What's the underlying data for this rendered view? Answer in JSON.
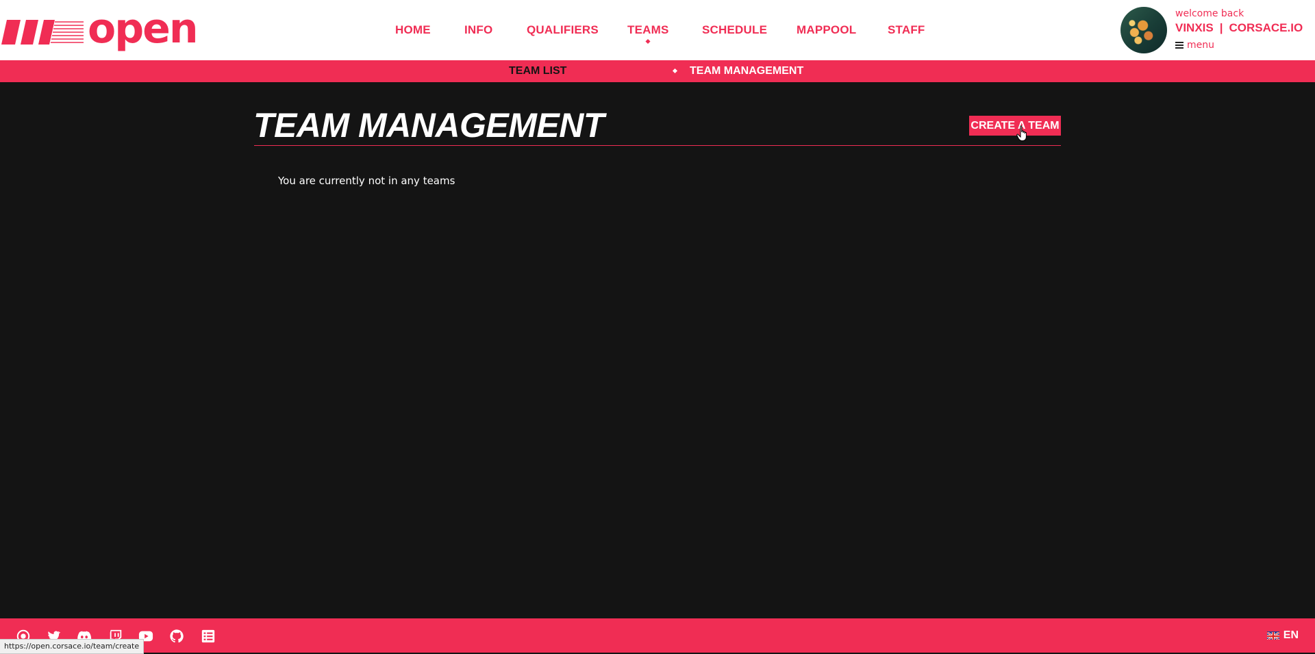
{
  "brand": {
    "logo_text": "open",
    "accent": "#f02d54"
  },
  "nav": {
    "items": [
      {
        "label": "HOME"
      },
      {
        "label": "INFO"
      },
      {
        "label": "QUALIFIERS"
      },
      {
        "label": "TEAMS"
      },
      {
        "label": "SCHEDULE"
      },
      {
        "label": "MAPPOOL"
      },
      {
        "label": "STAFF"
      }
    ],
    "active": "TEAMS"
  },
  "user": {
    "welcome": "welcome back",
    "name": "VINXIS",
    "separator": "|",
    "org": "CORSACE.IO",
    "menu_label": "menu"
  },
  "subnav": {
    "items": [
      {
        "label": "TEAM LIST"
      },
      {
        "label": "TEAM MANAGEMENT"
      }
    ],
    "active": "TEAM MANAGEMENT"
  },
  "main": {
    "title": "TEAM MANAGEMENT",
    "create_label": "CREATE A TEAM",
    "empty_message": "You are currently not in any teams"
  },
  "footer": {
    "social_icons": [
      "osu-icon",
      "twitter-icon",
      "discord-icon",
      "twitch-icon",
      "youtube-icon",
      "github-icon",
      "sheets-icon"
    ],
    "language": "EN"
  },
  "status_bar": {
    "url": "https://open.corsace.io/team/create"
  }
}
